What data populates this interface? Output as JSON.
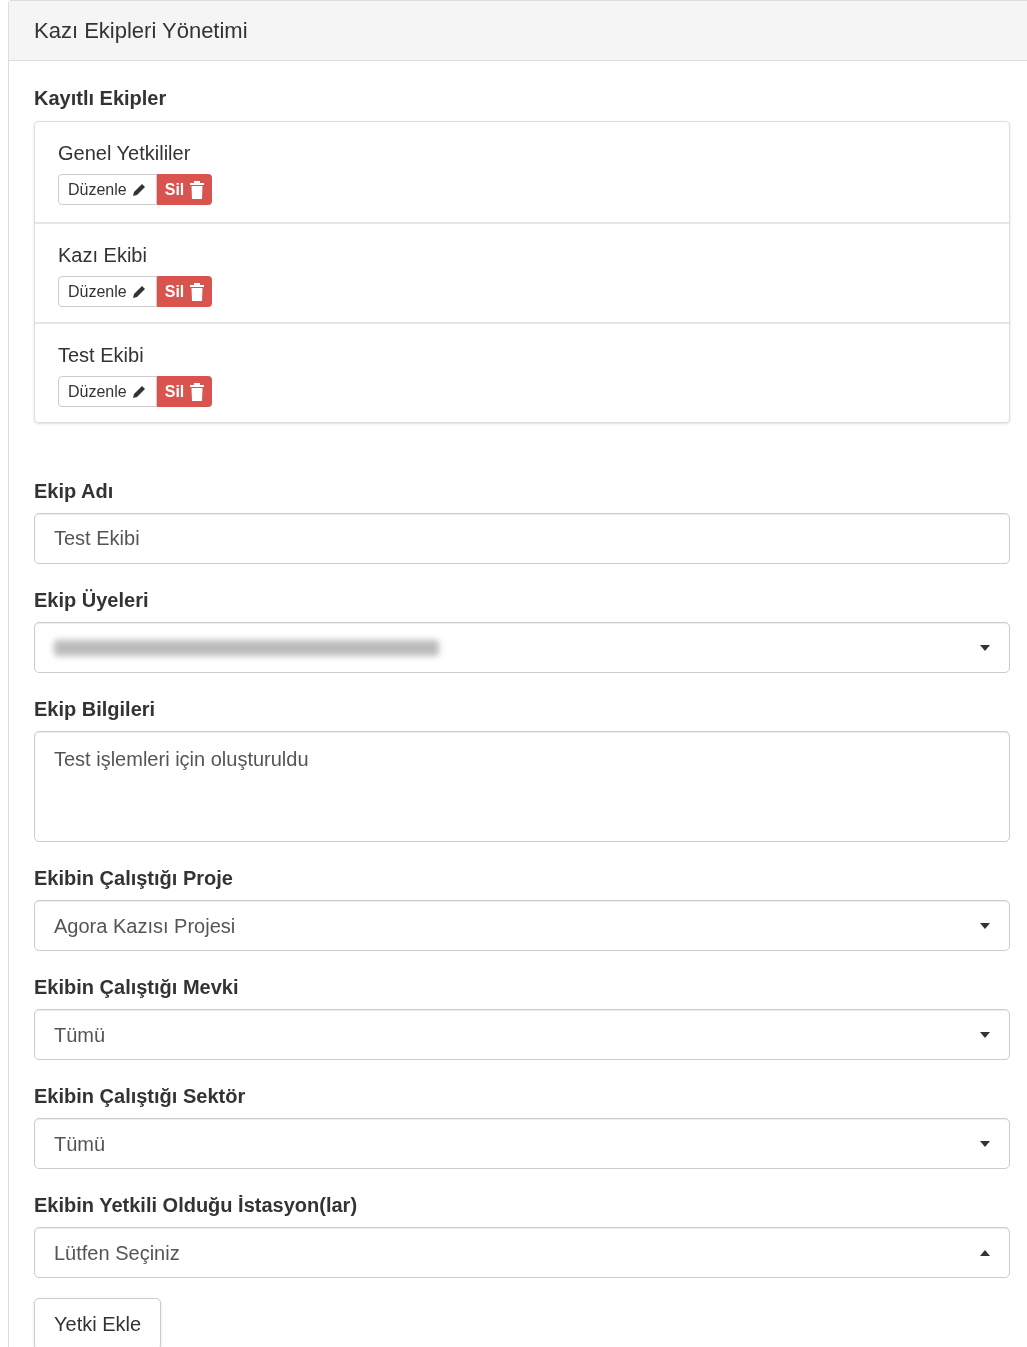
{
  "panel": {
    "title": "Kazı Ekipleri Yönetimi"
  },
  "teams": {
    "label": "Kayıtlı Ekipler",
    "items": [
      {
        "name": "Genel Yetkililer",
        "edit": "Düzenle",
        "delete": "Sil"
      },
      {
        "name": "Kazı Ekibi",
        "edit": "Düzenle",
        "delete": "Sil"
      },
      {
        "name": "Test Ekibi",
        "edit": "Düzenle",
        "delete": "Sil"
      }
    ]
  },
  "fields": [
    {
      "kind": "input",
      "label": "Ekip Adı",
      "value": "Test Ekibi"
    },
    {
      "kind": "select",
      "label": "Ekip Üyeleri",
      "blurred": true,
      "expanded": false
    },
    {
      "kind": "textarea",
      "label": "Ekip Bilgileri",
      "value": "Test işlemleri için oluşturuldu"
    },
    {
      "kind": "select",
      "label": "Ekibin Çalıştığı Proje",
      "value": "Agora Kazısı Projesi",
      "expanded": false
    },
    {
      "kind": "select",
      "label": "Ekibin Çalıştığı Mevki",
      "value": "Tümü",
      "expanded": false
    },
    {
      "kind": "select",
      "label": "Ekibin Çalıştığı Sektör",
      "value": "Tümü",
      "expanded": false
    },
    {
      "kind": "select",
      "label": "Ekibin Yetkili Olduğu İstasyon(lar)",
      "value": "Lütfen Seçiniz",
      "expanded": true
    }
  ],
  "add_button": "Yetki Ekle"
}
